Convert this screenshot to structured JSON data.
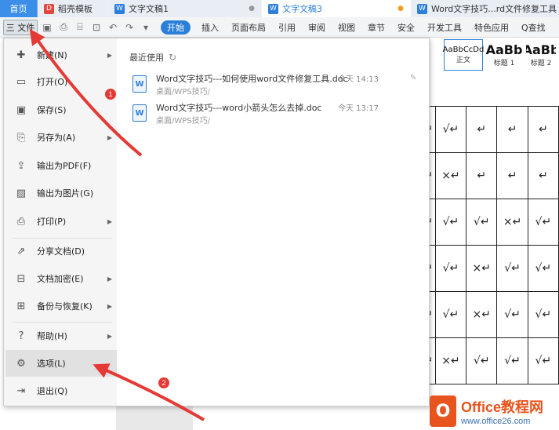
{
  "tabs": [
    {
      "label": "首页"
    },
    {
      "label": "稻壳模板"
    },
    {
      "label": "文字文稿1"
    },
    {
      "label": "文字文稿3"
    },
    {
      "label": "Word文字技巧...rd文件修复工具"
    }
  ],
  "ribbon": {
    "file_label": "三 文件",
    "tabs": [
      "开始",
      "插入",
      "页面布局",
      "引用",
      "审阅",
      "视图",
      "章节",
      "安全",
      "开发工具",
      "特色应用",
      "Q查找"
    ]
  },
  "styles": [
    {
      "sample": "AaBbCcDd",
      "name": "正文"
    },
    {
      "sample": "AaBb",
      "name": "标题 1"
    },
    {
      "sample": "AaBb",
      "name": "标题 2"
    }
  ],
  "file_menu": {
    "items": [
      {
        "label": "新建(N)",
        "icon": "new-doc-icon"
      },
      {
        "label": "打开(O)",
        "icon": "folder-icon"
      },
      {
        "label": "保存(S)",
        "icon": "save-icon"
      },
      {
        "label": "另存为(A)",
        "icon": "save-as-icon"
      },
      {
        "label": "输出为PDF(F)",
        "icon": "pdf-icon"
      },
      {
        "label": "输出为图片(G)",
        "icon": "image-icon"
      },
      {
        "label": "打印(P)",
        "icon": "print-icon"
      },
      {
        "label": "分享文档(D)",
        "icon": "share-icon"
      },
      {
        "label": "文档加密(E)",
        "icon": "lock-icon"
      },
      {
        "label": "备份与恢复(K)",
        "icon": "backup-icon"
      },
      {
        "label": "帮助(H)",
        "icon": "help-icon"
      },
      {
        "label": "选项(L)",
        "icon": "gear-icon"
      },
      {
        "label": "退出(Q)",
        "icon": "exit-icon"
      }
    ]
  },
  "recent": {
    "title": "最近使用",
    "files": [
      {
        "name": "Word文字技巧---如何使用word文件修复工具.doc",
        "path": "桌面/WPS技巧/",
        "time": "今天 14:13"
      },
      {
        "name": "Word文字技巧---word小箭头怎么去掉.doc",
        "path": "桌面/WPS技巧/",
        "time": "今天 13:17"
      }
    ]
  },
  "table": {
    "rows": [
      [
        "↵",
        "√↵",
        "↵",
        "↵",
        "↵"
      ],
      [
        "↵",
        "×↵",
        "↵",
        "↵",
        "↵"
      ],
      [
        "↵",
        "√↵",
        "√↵",
        "×↵",
        "√↵"
      ],
      [
        "↵",
        "√↵",
        "×↵",
        "√↵",
        "√↵"
      ],
      [
        "↵",
        "√↵",
        "×↵",
        "√↵",
        "√↵"
      ],
      [
        "↵",
        "×↵",
        "√↵",
        "√↵",
        "√↵"
      ]
    ]
  },
  "annotations": [
    "1",
    "2"
  ],
  "watermark": {
    "brand": "Office教程网",
    "url": "www.office26.com"
  },
  "colors": {
    "accent": "#2b7fd8",
    "annotation": "#e53935",
    "watermark": "#e8541e"
  }
}
